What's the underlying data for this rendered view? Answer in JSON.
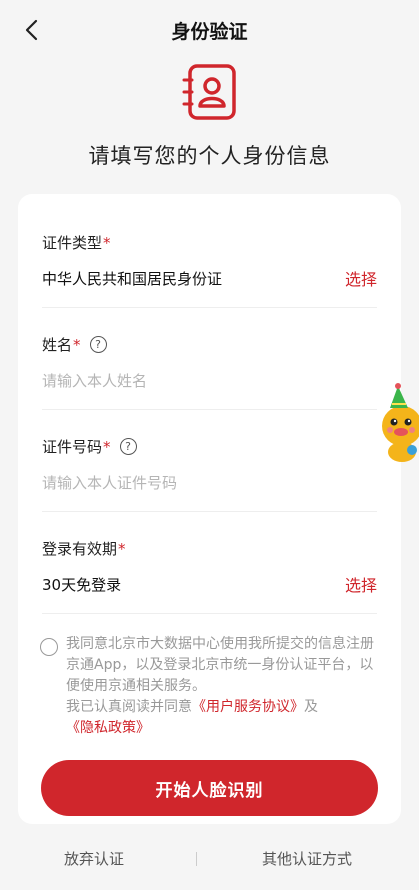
{
  "header": {
    "title": "身份验证",
    "back_icon": "chevron-left-icon"
  },
  "hero": {
    "icon": "id-card-icon",
    "text": "请填写您的个人身份信息"
  },
  "form": {
    "id_type": {
      "label": "证件类型",
      "required": "*",
      "value": "中华人民共和国居民身份证",
      "action": "选择"
    },
    "name": {
      "label": "姓名",
      "required": "*",
      "help": "?",
      "placeholder": "请输入本人姓名"
    },
    "id_number": {
      "label": "证件号码",
      "required": "*",
      "help": "?",
      "placeholder": "请输入本人证件号码"
    },
    "login_validity": {
      "label": "登录有效期",
      "required": "*",
      "value": "30天免登录",
      "action": "选择"
    }
  },
  "agreement": {
    "text_1": "我同意北京市大数据中心使用我所提交的信息注册京通App，以及登录北京市统一身份认证平台，以便使用京通相关服务。",
    "text_2": "我已认真阅读并同意",
    "link_terms": "《用户服务协议》",
    "and": "及",
    "link_privacy": "《隐私政策》"
  },
  "cta": {
    "label": "开始人脸识别"
  },
  "footer": {
    "abandon": "放弃认证",
    "other": "其他认证方式"
  },
  "colors": {
    "accent": "#d0262c",
    "background": "#f5f5f5",
    "card": "#ffffff"
  }
}
